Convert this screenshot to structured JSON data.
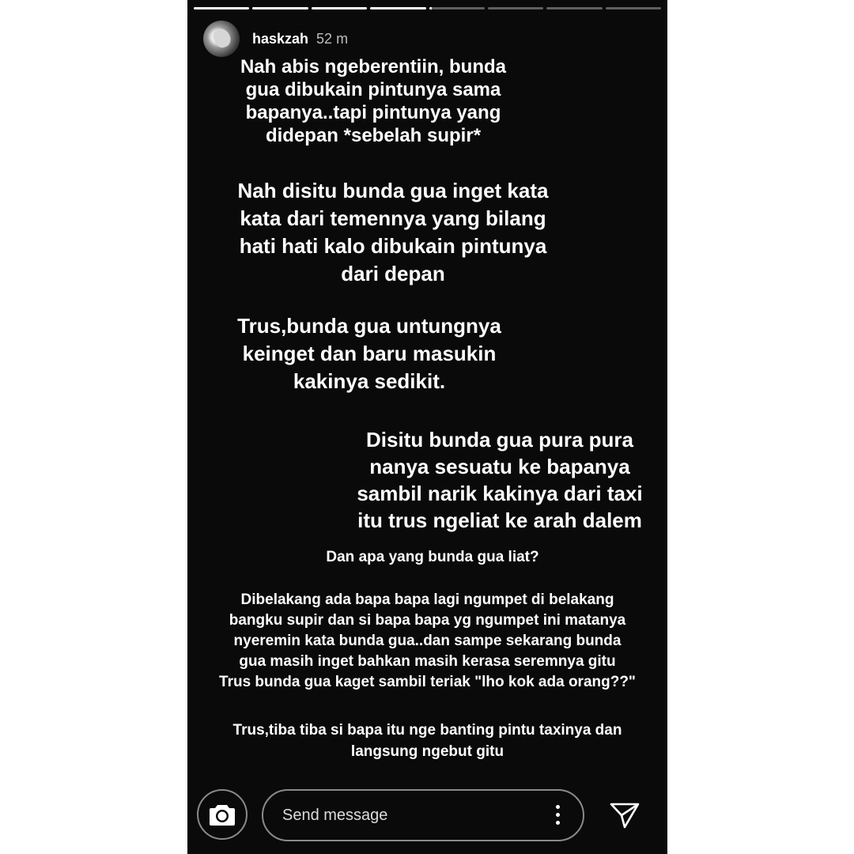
{
  "story": {
    "progress": [
      1,
      1,
      1,
      1,
      0.05,
      0,
      0,
      0
    ],
    "user": {
      "username": "haskzah",
      "time": "52 m"
    },
    "blocks": [
      "Nah abis ngeberentiin, bunda\ngua dibukain pintunya sama\nbapanya..tapi pintunya yang\ndidepan *sebelah supir*",
      "Nah disitu bunda gua inget kata\nkata dari temennya yang bilang\nhati hati kalo dibukain pintunya\ndari depan",
      "Trus,bunda gua untungnya\nkeinget dan baru masukin\nkakinya sedikit.",
      "Disitu bunda gua pura pura\nnanya sesuatu ke bapanya\nsambil narik kakinya dari taxi\nitu trus ngeliat ke arah dalem",
      "Dan apa yang bunda gua liat?",
      "Dibelakang ada bapa bapa lagi ngumpet di belakang\nbangku supir dan si bapa bapa yg ngumpet ini matanya\nnyeremin kata bunda gua..dan sampe sekarang bunda\ngua masih inget bahkan masih kerasa seremnya gitu\nTrus bunda gua kaget sambil teriak \"lho kok ada orang??\"",
      "Trus,tiba tiba si bapa itu nge banting pintu taxinya dan\nlangsung ngebut gitu"
    ],
    "reply": {
      "placeholder": "Send message",
      "icons": [
        "camera-icon",
        "more-vertical-icon",
        "send-icon"
      ]
    }
  }
}
